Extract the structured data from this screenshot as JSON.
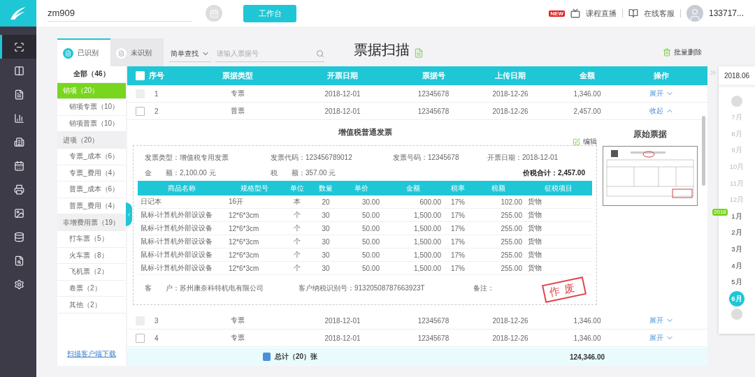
{
  "topbar": {
    "account": "zm909",
    "workbench": "工作台",
    "live_badge": "NEW",
    "live": "课程直播",
    "service": "在线客服",
    "user": "133717..."
  },
  "nav": [
    {
      "selected": true
    },
    {
      "selected": false
    },
    {
      "selected": false
    },
    {
      "selected": false
    },
    {
      "selected": false
    },
    {
      "selected": false
    },
    {
      "selected": false
    },
    {
      "selected": false
    },
    {
      "selected": false
    },
    {
      "selected": false
    },
    {
      "selected": false
    }
  ],
  "tabs": [
    {
      "label": "已识别",
      "selected": true
    },
    {
      "label": "未识别",
      "selected": false
    }
  ],
  "search": {
    "mode": "简单查找",
    "placeholder": "请输入票据号"
  },
  "title": "票据扫描",
  "bulk_delete": "批量删除",
  "categories": [
    {
      "label": "全部（46）",
      "kind": "all",
      "selected": false
    },
    {
      "label": "销项（20）",
      "kind": "group",
      "selected": true
    },
    {
      "label": "销项专票（10）",
      "kind": "item",
      "selected": false
    },
    {
      "label": "销项普票（10）",
      "kind": "item",
      "selected": false
    },
    {
      "label": "进项（20）",
      "kind": "group",
      "selected": false
    },
    {
      "label": "专票_成本（6）",
      "kind": "item",
      "selected": false
    },
    {
      "label": "专票_费用（4）",
      "kind": "item",
      "selected": false
    },
    {
      "label": "普票_成本（6）",
      "kind": "item",
      "selected": false
    },
    {
      "label": "普票_费用（4）",
      "kind": "item",
      "selected": false
    },
    {
      "label": "非增费用票（19）",
      "kind": "group",
      "selected": false
    },
    {
      "label": "打车票（5）",
      "kind": "item",
      "selected": false
    },
    {
      "label": "火车票（8）",
      "kind": "item",
      "selected": false
    },
    {
      "label": "飞机票（2）",
      "kind": "item",
      "selected": false
    },
    {
      "label": "卷票（2）",
      "kind": "item",
      "selected": false
    },
    {
      "label": "其他（2）",
      "kind": "item",
      "selected": false
    }
  ],
  "download_link": "扫描客户端下载",
  "table": {
    "columns": [
      "序号",
      "票据类型",
      "开票日期",
      "票据号",
      "上传日期",
      "金额",
      "操作"
    ],
    "rows": [
      {
        "cells": [
          "1",
          "专票",
          "2018-12-01",
          "12345678",
          "2018-12-26",
          "1,346.00"
        ],
        "action": "展开",
        "disabled": true,
        "checked": false,
        "expanded": false
      },
      {
        "cells": [
          "2",
          "普票",
          "2018-12-01",
          "12345678",
          "2018-12-26",
          "2,457.00"
        ],
        "action": "收起",
        "disabled": false,
        "checked": false,
        "expanded": true
      },
      {
        "cells": [
          "3",
          "专票",
          "2018-12-01",
          "12345678",
          "2018-12-26",
          "1,346.00"
        ],
        "action": "展开",
        "disabled": true,
        "checked": false,
        "expanded": false
      },
      {
        "cells": [
          "4",
          "专票",
          "2018-12-01",
          "12345678",
          "2018-12-26",
          "1,346.00"
        ],
        "action": "展开",
        "disabled": false,
        "checked": false,
        "expanded": false
      }
    ],
    "select_all": {
      "checked": false
    },
    "total_label": "总计（20）张",
    "total": "124,346.00"
  },
  "detail": {
    "title": "增值税普通发票",
    "edit": "编辑",
    "original_title": "原始票据",
    "fields": [
      [
        {
          "text": "发票类型：增值税专用发票",
          "emphasis": false
        },
        {
          "text": "发票代码：123456789012",
          "emphasis": false
        },
        {
          "text": "发票号码：12345678",
          "emphasis": false
        },
        {
          "text": "开票日期：2018-12-01",
          "emphasis": false
        }
      ],
      [
        {
          "text": "金　　额：2,100.00 元",
          "emphasis": false
        },
        {
          "text": "税　　额：357.00 元",
          "emphasis": false
        },
        {
          "text": "价税合计：2,457.00",
          "emphasis": true
        }
      ]
    ],
    "columns": [
      "商品名称",
      "规格型号",
      "单位",
      "数量",
      "单价",
      "金额",
      "税率",
      "税额",
      "征税项目"
    ],
    "rows": [
      [
        "日记本",
        "16开",
        "本",
        "20",
        "30.00",
        "600.00",
        "17%",
        "102.00",
        "货物"
      ],
      [
        "鼠标-计算机外部设设备",
        "12*6*3cm",
        "个",
        "30",
        "50.00",
        "1,500.00",
        "17%",
        "255.00",
        "货物"
      ],
      [
        "鼠标-计算机外部设设备",
        "12*6*3cm",
        "个",
        "30",
        "50.00",
        "1,500.00",
        "17%",
        "255.00",
        "货物"
      ],
      [
        "鼠标-计算机外部设设备",
        "12*6*3cm",
        "个",
        "30",
        "50.00",
        "1,500.00",
        "17%",
        "255.00",
        "货物"
      ],
      [
        "鼠标-计算机外部设设备",
        "12*6*3cm",
        "个",
        "30",
        "50.00",
        "1,500.00",
        "17%",
        "255.00",
        "货物"
      ],
      [
        "鼠标-计算机外部设设备",
        "12*6*3cm",
        "个",
        "30",
        "50.00",
        "1,500.00",
        "17%",
        "255.00",
        "货物"
      ]
    ],
    "footer": [
      "客　　户：苏州康奈科特机电有限公司",
      "客户纳税识别号：91320508787663923T",
      "备注："
    ],
    "stamp": "作废"
  },
  "calendar": {
    "header": "2018.06",
    "months": [
      {
        "label": "7月",
        "disabled": true,
        "selected": false
      },
      {
        "label": "8月",
        "disabled": true,
        "selected": false
      },
      {
        "label": "9月",
        "disabled": true,
        "selected": false
      },
      {
        "label": "10月",
        "disabled": true,
        "selected": false
      },
      {
        "label": "11月",
        "disabled": true,
        "selected": false
      },
      {
        "label": "12月",
        "disabled": true,
        "selected": false
      },
      {
        "label": "1月",
        "disabled": false,
        "selected": false,
        "badge": "2018"
      },
      {
        "label": "2月",
        "disabled": false,
        "selected": false
      },
      {
        "label": "3月",
        "disabled": false,
        "selected": false
      },
      {
        "label": "4月",
        "disabled": false,
        "selected": false
      },
      {
        "label": "5月",
        "disabled": false,
        "selected": false
      },
      {
        "label": "6月",
        "disabled": false,
        "selected": true
      }
    ]
  }
}
